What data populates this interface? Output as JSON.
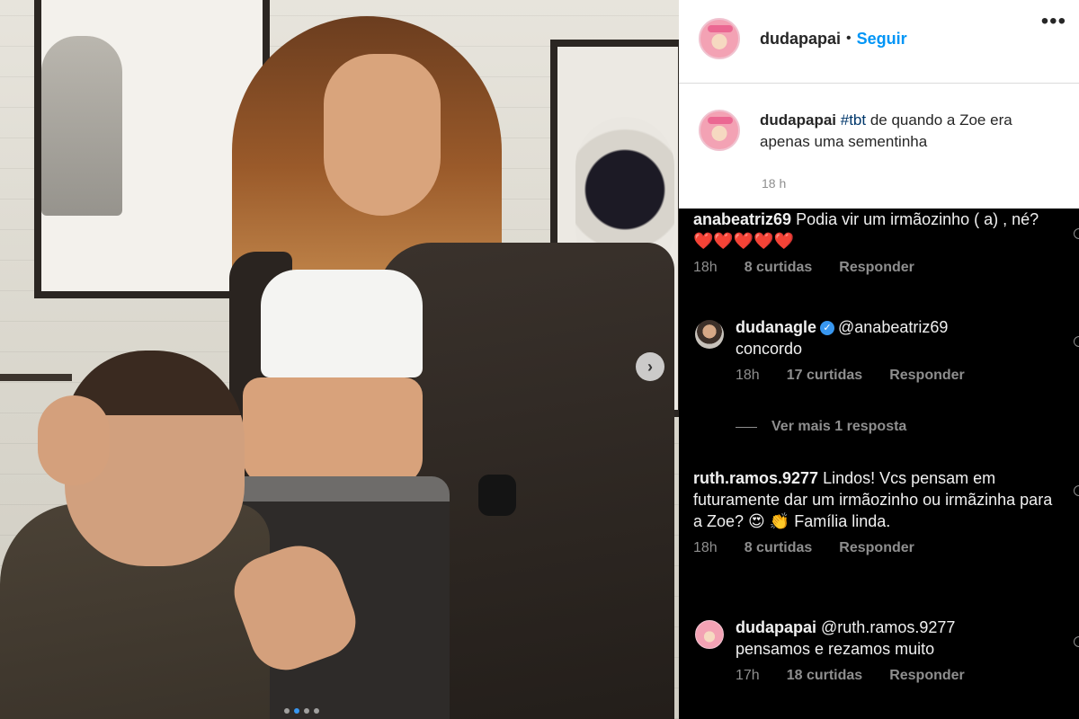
{
  "post": {
    "username": "dudapapai",
    "separator": "•",
    "follow_label": "Seguir",
    "more_icon": "•••",
    "caption_user": "dudapapai",
    "caption_hashtag": "#tbt",
    "caption_text": " de quando a Zoe era apenas uma sementinha",
    "caption_time": "18 h",
    "carousel_next": "›"
  },
  "comments": [
    {
      "user": "anabeatriz69",
      "text": " Podia vir um irmãozinho ( a) , né?",
      "hearts": "❤️❤️❤️❤️❤️",
      "time": "18h",
      "likes": "8 curtidas",
      "reply": "Responder"
    },
    {
      "user": "dudanagle",
      "verified_mark": "✓",
      "mention": "@anabeatriz69",
      "text": "concordo",
      "time": "18h",
      "likes": "17 curtidas",
      "reply": "Responder"
    },
    {
      "view_more": "Ver mais 1 resposta"
    },
    {
      "user": "ruth.ramos.9277",
      "text": " Lindos! Vcs pensam em futuramente dar um irmãozinho ou irmãzinha para a Zoe? 😍 👏 Família linda.",
      "time": "18h",
      "likes": "8 curtidas",
      "reply": "Responder"
    },
    {
      "user": "dudapapai",
      "mention": "@ruth.ramos.9277",
      "text": "pensamos e rezamos muito",
      "time": "17h",
      "likes": "18 curtidas",
      "reply": "Responder"
    }
  ],
  "colors": {
    "link_blue": "#0095f6",
    "hashtag": "#00376b",
    "heart_red": "#e0245e",
    "verified_blue": "#3897f0"
  }
}
